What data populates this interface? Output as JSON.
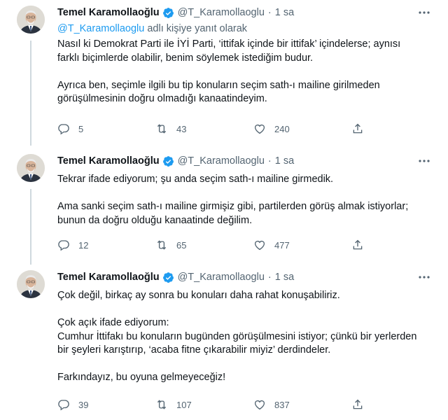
{
  "tweets": [
    {
      "name": "Temel Karamollaoğlu",
      "handle": "@T_Karamollaoglu",
      "dot": "·",
      "time": "1 sa",
      "reply_mention": "@T_Karamollaoglu",
      "reply_suffix": " adlı kişiye yanıt olarak",
      "paragraphs": [
        "Nasıl ki Demokrat Parti ile İYİ Parti, ‘ittifak içinde bir ittifak’ içindelerse; aynısı farklı biçimlerde olabilir, benim söylemek istediğim budur.",
        "Ayrıca ben, seçimle ilgili bu tip konuların seçim sath-ı mailine girilmeden görüşülmesinin doğru olmadığı kanaatindeyim."
      ],
      "replies": "5",
      "retweets": "43",
      "likes": "240"
    },
    {
      "name": "Temel Karamollaoğlu",
      "handle": "@T_Karamollaoglu",
      "dot": "·",
      "time": "1 sa",
      "paragraphs": [
        "Tekrar ifade ediyorum; şu anda seçim sath-ı mailine girmedik.",
        "Ama sanki seçim sath-ı mailine girmişiz gibi, partilerden görüş almak istiyorlar; bunun da doğru olduğu kanaatinde değilim."
      ],
      "replies": "12",
      "retweets": "65",
      "likes": "477"
    },
    {
      "name": "Temel Karamollaoğlu",
      "handle": "@T_Karamollaoglu",
      "dot": "·",
      "time": "1 sa",
      "paragraphs": [
        "Çok değil, birkaç ay sonra bu konuları daha rahat konuşabiliriz.",
        "Çok açık ifade ediyorum:\nCumhur İttifakı bu konuların bugünden görüşülmesini istiyor; çünkü bir yerlerden bir şeyleri karıştırıp, ‘acaba fitne çıkarabilir miyiz’ derdindeler.",
        "Farkındayız, bu oyuna gelmeyeceğiz!"
      ],
      "replies": "39",
      "retweets": "107",
      "likes": "837"
    }
  ],
  "colors": {
    "accent": "#1d9bf0",
    "muted": "#536471",
    "text": "#0f1419",
    "verified": "#1d9bf0"
  },
  "icons": [
    "more-icon",
    "verified-icon",
    "reply-icon",
    "retweet-icon",
    "like-icon",
    "share-icon"
  ]
}
